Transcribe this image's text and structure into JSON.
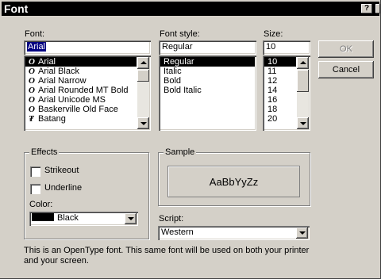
{
  "window": {
    "title": "Font",
    "help_label": "?"
  },
  "font": {
    "label": "Font:",
    "value": "Arial",
    "items": [
      {
        "name": "Arial",
        "selected": true
      },
      {
        "name": "Arial Black",
        "selected": false
      },
      {
        "name": "Arial Narrow",
        "selected": false
      },
      {
        "name": "Arial Rounded MT Bold",
        "selected": false
      },
      {
        "name": "Arial Unicode MS",
        "selected": false
      },
      {
        "name": "Baskerville Old Face",
        "selected": false
      },
      {
        "name": "Batang",
        "selected": false
      }
    ],
    "icon_opentype": "opentype-icon",
    "icon_truetype": "truetype-icon"
  },
  "style": {
    "label": "Font style:",
    "value": "Regular",
    "items": [
      "Regular",
      "Italic",
      "Bold",
      "Bold Italic"
    ]
  },
  "size": {
    "label": "Size:",
    "value": "10",
    "items": [
      "10",
      "11",
      "12",
      "14",
      "16",
      "18",
      "20"
    ]
  },
  "buttons": {
    "ok": "OK",
    "cancel": "Cancel"
  },
  "effects": {
    "title": "Effects",
    "strikeout": "Strikeout",
    "underline": "Underline",
    "color_label": "Color:",
    "color_value": "Black",
    "color_swatch": "#000000"
  },
  "sample": {
    "title": "Sample",
    "text": "AaBbYyZz"
  },
  "script": {
    "label": "Script:",
    "value": "Western"
  },
  "description": "This is an OpenType font. This same font will be used on both your printer and your screen."
}
